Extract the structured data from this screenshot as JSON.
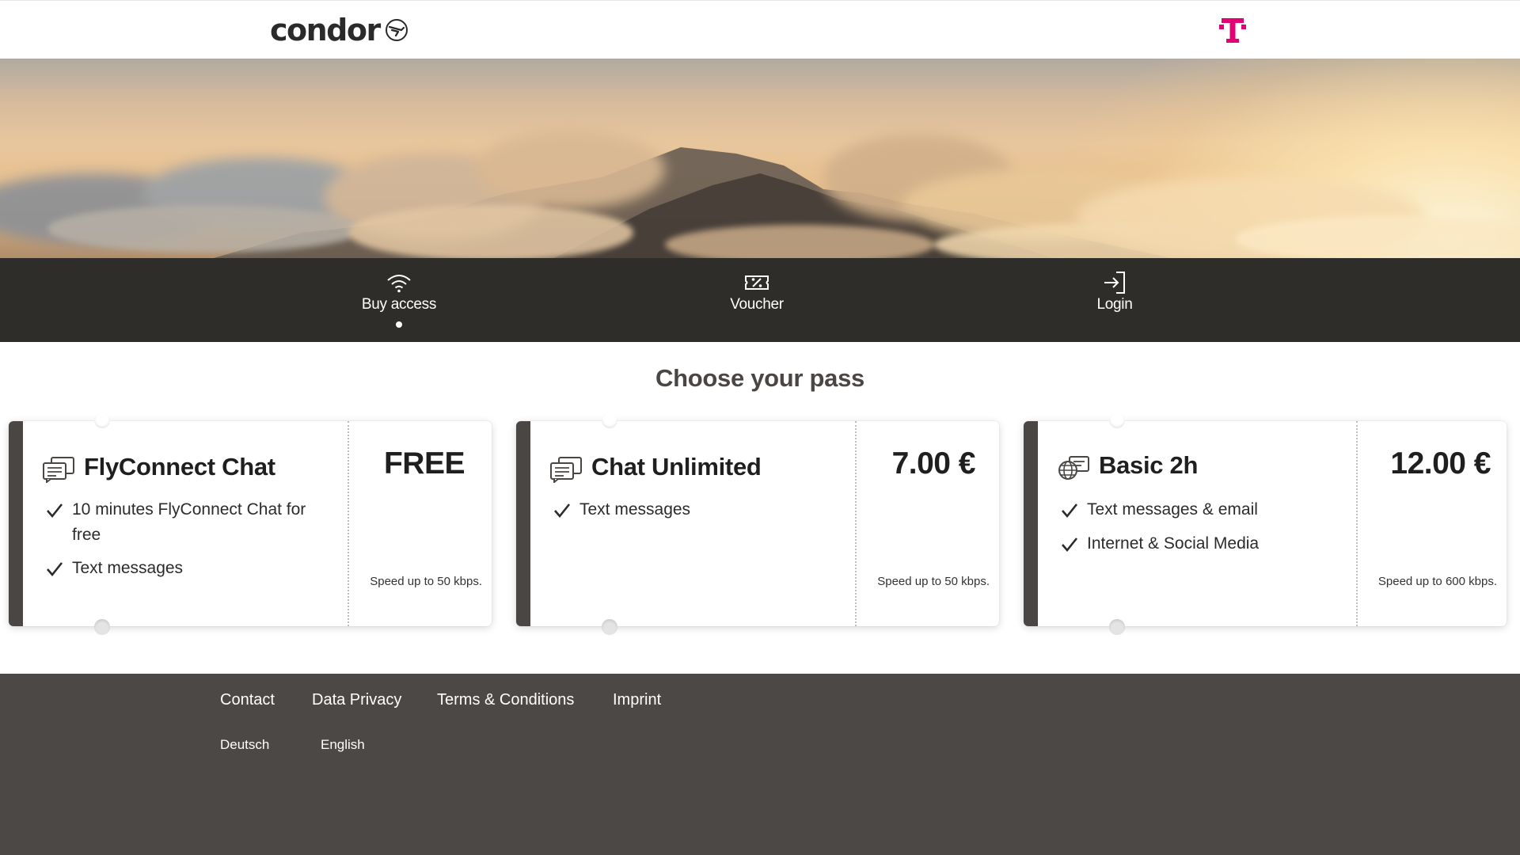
{
  "header": {
    "brand": "condor",
    "brand_icon": "bird-icon",
    "partner_icon": "telekom-t-icon",
    "partner_color": "#e20074"
  },
  "nav": {
    "items": [
      {
        "label": "Buy access",
        "icon": "wifi-icon",
        "active": true
      },
      {
        "label": "Voucher",
        "icon": "voucher-percent-icon",
        "active": false
      },
      {
        "label": "Login",
        "icon": "login-arrow-icon",
        "active": false
      }
    ]
  },
  "main": {
    "title": "Choose your pass",
    "passes": [
      {
        "name": "FlyConnect Chat",
        "icon": "chat-bubbles-icon",
        "price": "FREE",
        "features": [
          "10 minutes FlyConnect Chat for free",
          "Text messages"
        ],
        "speed": "Speed up to 50 kbps."
      },
      {
        "name": "Chat Unlimited",
        "icon": "chat-bubbles-icon",
        "price": "7.00 €",
        "features": [
          "Text messages"
        ],
        "speed": "Speed up to 50 kbps."
      },
      {
        "name": "Basic 2h",
        "icon": "globe-chat-icon",
        "price": "12.00 €",
        "features": [
          "Text messages & email",
          "Internet & Social Media"
        ],
        "speed": "Speed up to 600 kbps."
      }
    ]
  },
  "footer": {
    "links": [
      "Contact",
      "Data Privacy",
      "Terms & Conditions",
      "Imprint"
    ],
    "languages": [
      "Deutsch",
      "English"
    ]
  },
  "colors": {
    "nav_bg": "#2f2d2a",
    "footer_bg": "#4b4845",
    "card_edge": "#4a4643"
  }
}
